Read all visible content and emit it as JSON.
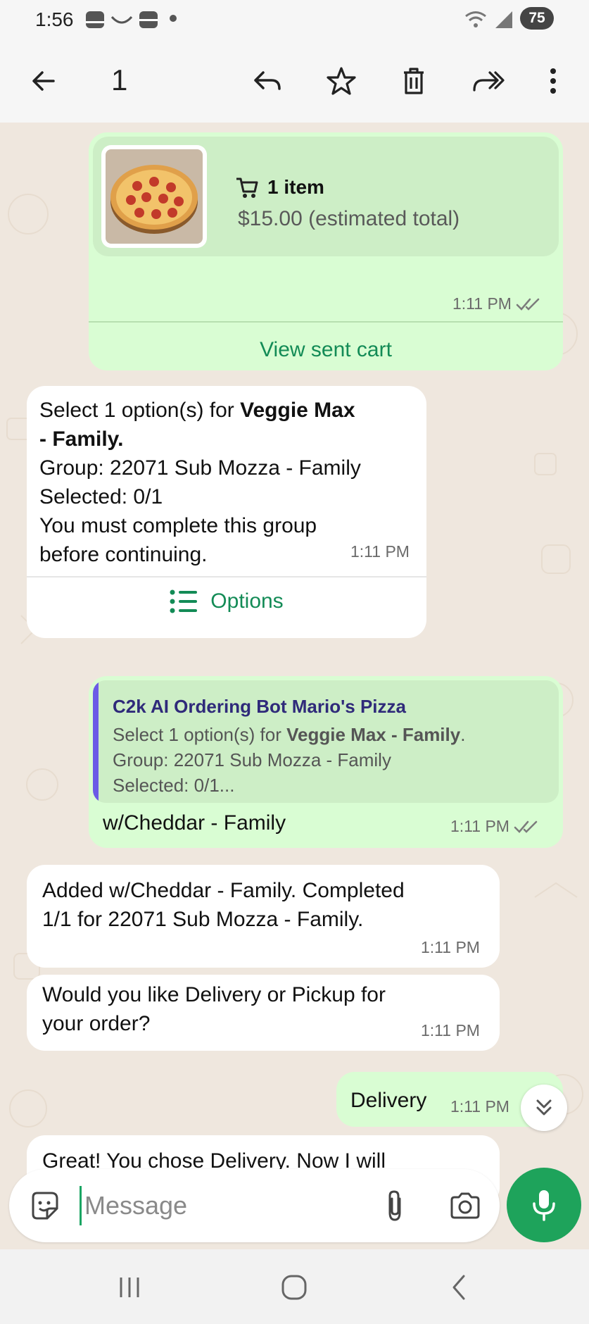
{
  "status_bar": {
    "time": "1:56",
    "battery": "75"
  },
  "toolbar": {
    "selected_count": "1"
  },
  "messages": {
    "cart": {
      "title": "1 item",
      "subtitle": "$15.00 (estimated total)",
      "time": "1:11 PM",
      "button_label": "View sent cart"
    },
    "options_prompt": {
      "line1_prefix": "Select 1 option(s) for ",
      "line1_bold": "Veggie Max",
      "line2_bold": "- Family.",
      "line3": "Group: 22071 Sub Mozza - Family",
      "line4": "Selected: 0/1",
      "line5": "You must complete this group",
      "line6": "before continuing.",
      "time": "1:11 PM",
      "button_label": "Options"
    },
    "reply": {
      "quote_name": "C2k AI Ordering Bot Mario's Pizza",
      "quote_line1_prefix": "Select 1 option(s) for ",
      "quote_line1_bold": "Veggie Max - Family",
      "quote_line1_suffix": ".",
      "quote_line2": "Group: 22071 Sub Mozza - Family",
      "quote_line3": "Selected: 0/1...",
      "text": "w/Cheddar - Family",
      "time": "1:11 PM"
    },
    "added": {
      "line1": "Added w/Cheddar - Family. Completed",
      "line2": "1/1 for 22071 Sub Mozza - Family.",
      "time": "1:11 PM"
    },
    "delivery_question": {
      "line1": "Would you like Delivery or Pickup for",
      "line2": "your order?",
      "time": "1:11 PM"
    },
    "delivery_answer": {
      "text": "Delivery",
      "time": "1:11 PM"
    },
    "partial": {
      "text": "Great! You chose Delivery. Now I will"
    }
  },
  "composer": {
    "placeholder": "Message"
  },
  "icons": {
    "back": "arrow-left-icon",
    "reply": "reply-icon",
    "star": "star-icon",
    "delete": "trash-icon",
    "forward": "forward-icon",
    "more": "more-vert-icon",
    "cart": "cart-icon",
    "list": "list-icon",
    "emoji": "sticker-icon",
    "attach": "paperclip-icon",
    "camera": "camera-icon",
    "mic": "mic-icon",
    "scroll": "double-chevron-down-icon"
  },
  "colors": {
    "accent": "#1ea35b",
    "outgoing": "#d9fdd3",
    "incoming": "#ffffff",
    "quote_bar": "#6b5be6",
    "read_ticks": "#53bdeb"
  }
}
